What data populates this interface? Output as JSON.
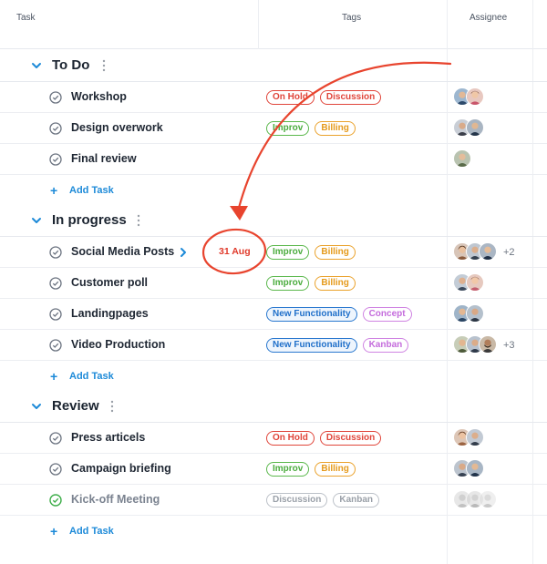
{
  "header": {
    "task": "Task",
    "tags": "Tags",
    "assignee": "Assignee"
  },
  "groups": [
    {
      "title": "To Do",
      "tasks": [
        {
          "name": "Workshop",
          "tags": [
            {
              "label": "On Hold",
              "color": "red"
            },
            {
              "label": "Discussion",
              "color": "red"
            }
          ]
        },
        {
          "name": "Design overwork",
          "tags": [
            {
              "label": "Improv",
              "color": "green"
            },
            {
              "label": "Billing",
              "color": "orange"
            }
          ]
        },
        {
          "name": "Final review",
          "tags": []
        }
      ],
      "add_label": "Add Task"
    },
    {
      "title": "In progress",
      "tasks": [
        {
          "name": "Social Media Posts",
          "due": "31 Aug",
          "tags": [
            {
              "label": "Improv",
              "color": "green"
            },
            {
              "label": "Billing",
              "color": "orange"
            }
          ],
          "more": "+2"
        },
        {
          "name": "Customer poll",
          "tags": [
            {
              "label": "Improv",
              "color": "green"
            },
            {
              "label": "Billing",
              "color": "orange"
            }
          ]
        },
        {
          "name": "Landingpages",
          "tags": [
            {
              "label": "New Functionality",
              "color": "blue"
            },
            {
              "label": "Concept",
              "color": "purple"
            }
          ]
        },
        {
          "name": "Video Production",
          "tags": [
            {
              "label": "New Functionality",
              "color": "blue"
            },
            {
              "label": "Kanban",
              "color": "purple"
            }
          ],
          "more": "+3"
        }
      ],
      "add_label": "Add Task"
    },
    {
      "title": "Review",
      "tasks": [
        {
          "name": "Press articels",
          "tags": [
            {
              "label": "On Hold",
              "color": "red"
            },
            {
              "label": "Discussion",
              "color": "red"
            }
          ]
        },
        {
          "name": "Campaign briefing",
          "tags": [
            {
              "label": "Improv",
              "color": "green"
            },
            {
              "label": "Billing",
              "color": "orange"
            }
          ]
        },
        {
          "name": "Kick-off Meeting",
          "done": true,
          "tags": [
            {
              "label": "Discussion",
              "color": "gray"
            },
            {
              "label": "Kanban",
              "color": "gray"
            }
          ]
        }
      ],
      "add_label": "Add Task"
    }
  ],
  "colors": {
    "accent": "#1d8ad8",
    "annotation": "#e8442e",
    "check_done": "#3fae4b"
  },
  "icons": {
    "group_toggle": "chevron-down-icon",
    "task_status": "check-circle-icon",
    "group_menu": "more-vertical-icon",
    "add": "plus-icon",
    "open_task": "chevron-right-icon"
  }
}
